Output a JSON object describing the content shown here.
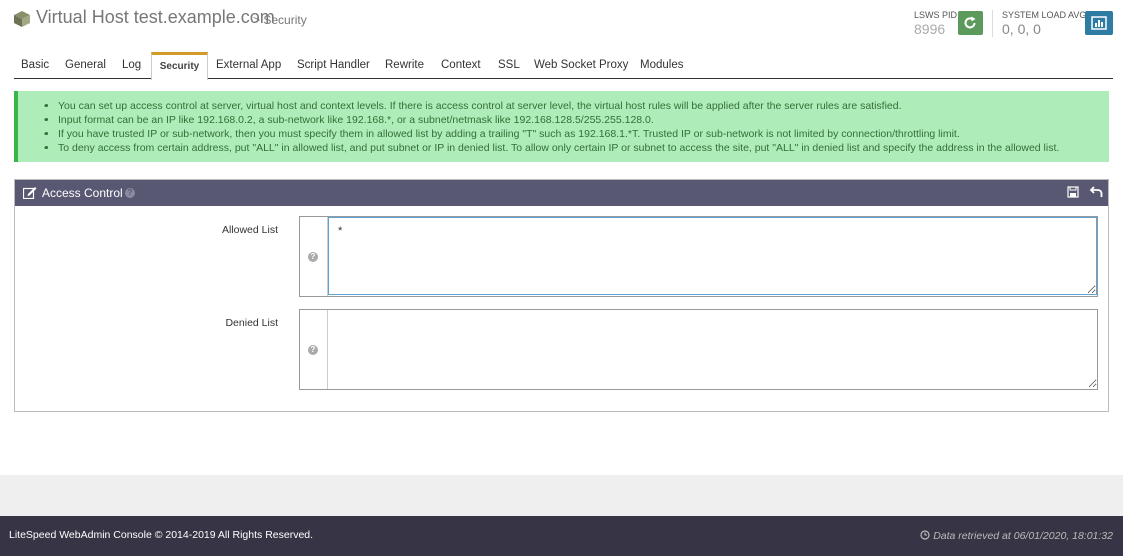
{
  "header": {
    "title": "Virtual Host test.example.com",
    "subtitle": "> Security",
    "pid_label": "LSWS PID",
    "pid_value": "8996",
    "load_label": "SYSTEM LOAD AVG",
    "load_value": "0, 0, 0"
  },
  "tabs": [
    {
      "label": "Basic"
    },
    {
      "label": "General"
    },
    {
      "label": "Log"
    },
    {
      "label": "Security",
      "active": true
    },
    {
      "label": "External App"
    },
    {
      "label": "Script Handler"
    },
    {
      "label": "Rewrite"
    },
    {
      "label": "Context"
    },
    {
      "label": "SSL"
    },
    {
      "label": "Web Socket Proxy"
    },
    {
      "label": "Modules"
    }
  ],
  "alert": {
    "items": [
      "You can set up access control at server, virtual host and context levels. If there is access control at server level, the virtual host rules will be applied after the server rules are satisfied.",
      "Input format can be an IP like 192.168.0.2, a sub-network like 192.168.*, or a subnet/netmask like 192.168.128.5/255.255.128.0.",
      "If you have trusted IP or sub-network, then you must specify them in allowed list by adding a trailing \"T\" such as 192.168.1.*T. Trusted IP or sub-network is not limited by connection/throttling limit.",
      "To deny access from certain address, put \"ALL\" in allowed list, and put subnet or IP in denied list. To allow only certain IP or subnet to access the site, put \"ALL\" in denied list and specify the address in the allowed list."
    ]
  },
  "panel": {
    "title": "Access Control",
    "help_glyph": "?",
    "allowed_label": "Allowed List",
    "allowed_value": "*",
    "denied_label": "Denied List",
    "denied_value": ""
  },
  "footer": {
    "copyright": "LiteSpeed WebAdmin Console © 2014-2019 All Rights Reserved.",
    "retrieved": "Data retrieved at 06/01/2020, 18:01:32"
  },
  "colors": {
    "accent_tab": "#d39b2a",
    "panel_header": "#595873",
    "alert_bg": "#aeedba",
    "restart_btn": "#5b9a5b",
    "stats_btn": "#2e7ba4",
    "footer_bg": "#373545"
  },
  "icons": [
    "cube-icon",
    "refresh-icon",
    "bar-chart-icon",
    "edit-icon",
    "help-icon",
    "save-icon",
    "undo-icon",
    "clock-icon"
  ]
}
